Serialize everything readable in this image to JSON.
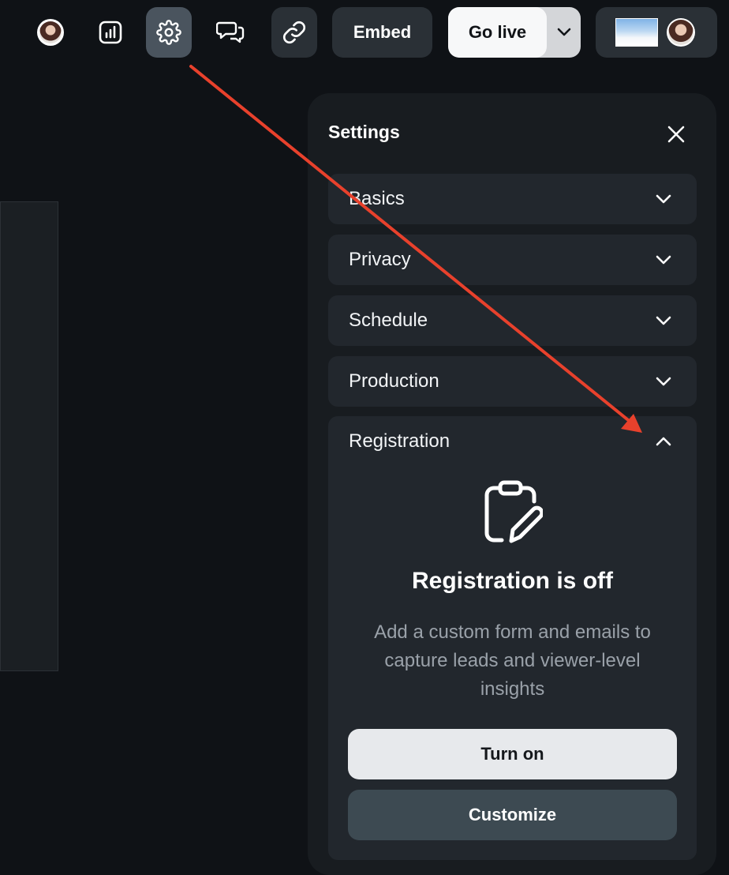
{
  "toolbar": {
    "embed_label": "Embed",
    "go_live_label": "Go live",
    "icons": [
      "avatar-icon",
      "analytics-icon",
      "gear-icon",
      "chat-icon",
      "link-icon"
    ]
  },
  "settings": {
    "title": "Settings",
    "sections": [
      {
        "label": "Basics",
        "expanded": false
      },
      {
        "label": "Privacy",
        "expanded": false
      },
      {
        "label": "Schedule",
        "expanded": false
      },
      {
        "label": "Production",
        "expanded": false
      },
      {
        "label": "Registration",
        "expanded": true
      }
    ],
    "registration": {
      "heading": "Registration is off",
      "description": "Add a custom form and emails to capture leads and viewer-level insights",
      "turn_on_label": "Turn on",
      "customize_label": "Customize"
    }
  },
  "colors": {
    "background": "#0f1216",
    "panel": "#181c20",
    "section": "#22272d",
    "annotation_arrow": "#e8412c",
    "active_icon_bg": "#4a545e"
  }
}
